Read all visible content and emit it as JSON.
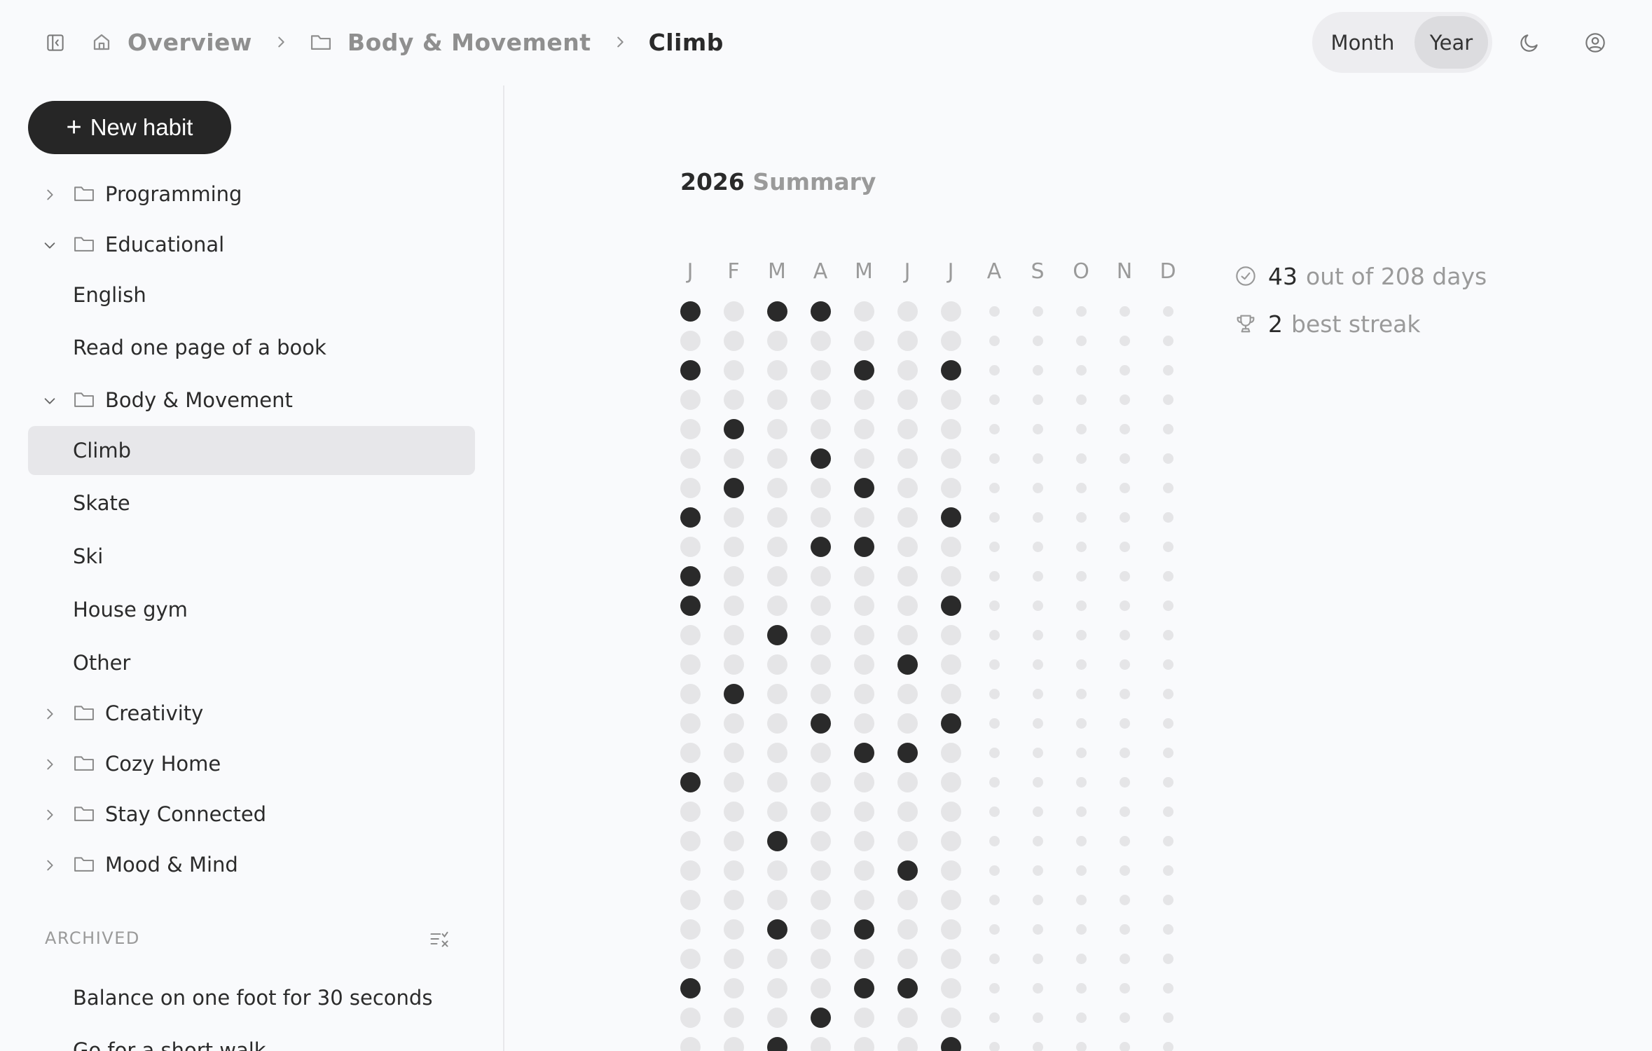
{
  "breadcrumb": {
    "items": [
      {
        "label": "Overview",
        "icon": "home-icon"
      },
      {
        "label": "Body & Movement",
        "icon": "folder-icon"
      },
      {
        "label": "Climb",
        "icon": ""
      }
    ]
  },
  "view_toggle": {
    "month_label": "Month",
    "year_label": "Year",
    "selected": "Year"
  },
  "sidebar": {
    "new_habit_label": "New habit",
    "items": [
      {
        "type": "folder",
        "label": "Programming",
        "expanded": false
      },
      {
        "type": "folder",
        "label": "Educational",
        "expanded": true
      },
      {
        "type": "habit",
        "label": "English"
      },
      {
        "type": "habit",
        "label": "Read one page of a book"
      },
      {
        "type": "folder",
        "label": "Body & Movement",
        "expanded": true
      },
      {
        "type": "habit",
        "label": "Climb",
        "selected": true
      },
      {
        "type": "habit",
        "label": "Skate"
      },
      {
        "type": "habit",
        "label": "Ski"
      },
      {
        "type": "habit",
        "label": "House gym"
      },
      {
        "type": "habit",
        "label": "Other"
      },
      {
        "type": "folder",
        "label": "Creativity",
        "expanded": false
      },
      {
        "type": "folder",
        "label": "Cozy Home",
        "expanded": false
      },
      {
        "type": "folder",
        "label": "Stay Connected",
        "expanded": false
      },
      {
        "type": "folder",
        "label": "Mood & Mind",
        "expanded": false
      }
    ],
    "archived_label": "ARCHIVED",
    "archived_items": [
      {
        "label": "Balance on one foot for 30 seconds"
      },
      {
        "label": "Go for a short walk"
      }
    ]
  },
  "summary": {
    "year": "2026",
    "word": "Summary",
    "months": [
      "J",
      "F",
      "M",
      "A",
      "M",
      "J",
      "J",
      "A",
      "S",
      "O",
      "N",
      "D"
    ],
    "done_days": [
      [
        1,
        3,
        8,
        10,
        11,
        17,
        24
      ],
      [
        5,
        7,
        14
      ],
      [
        1,
        12,
        19,
        22,
        26
      ],
      [
        1,
        6,
        9,
        15,
        25
      ],
      [
        3,
        7,
        9,
        16,
        22,
        24
      ],
      [
        13,
        16,
        20,
        24
      ],
      [
        3,
        8,
        11,
        15,
        26
      ],
      [],
      [],
      [],
      [],
      []
    ],
    "past_months": 7,
    "visible_rows": 26
  },
  "stats": {
    "done_count": "43",
    "done_text": "out of 208 days",
    "streak_count": "2",
    "streak_text": "best streak"
  },
  "colors": {
    "accent": "#262626",
    "done_dot": "#2a2a2a",
    "empty_dot": "#e5e5e7",
    "future_dot": "#e5e5e7",
    "muted_text": "#9a9a9a",
    "selected_bg": "#e7e7ea"
  }
}
